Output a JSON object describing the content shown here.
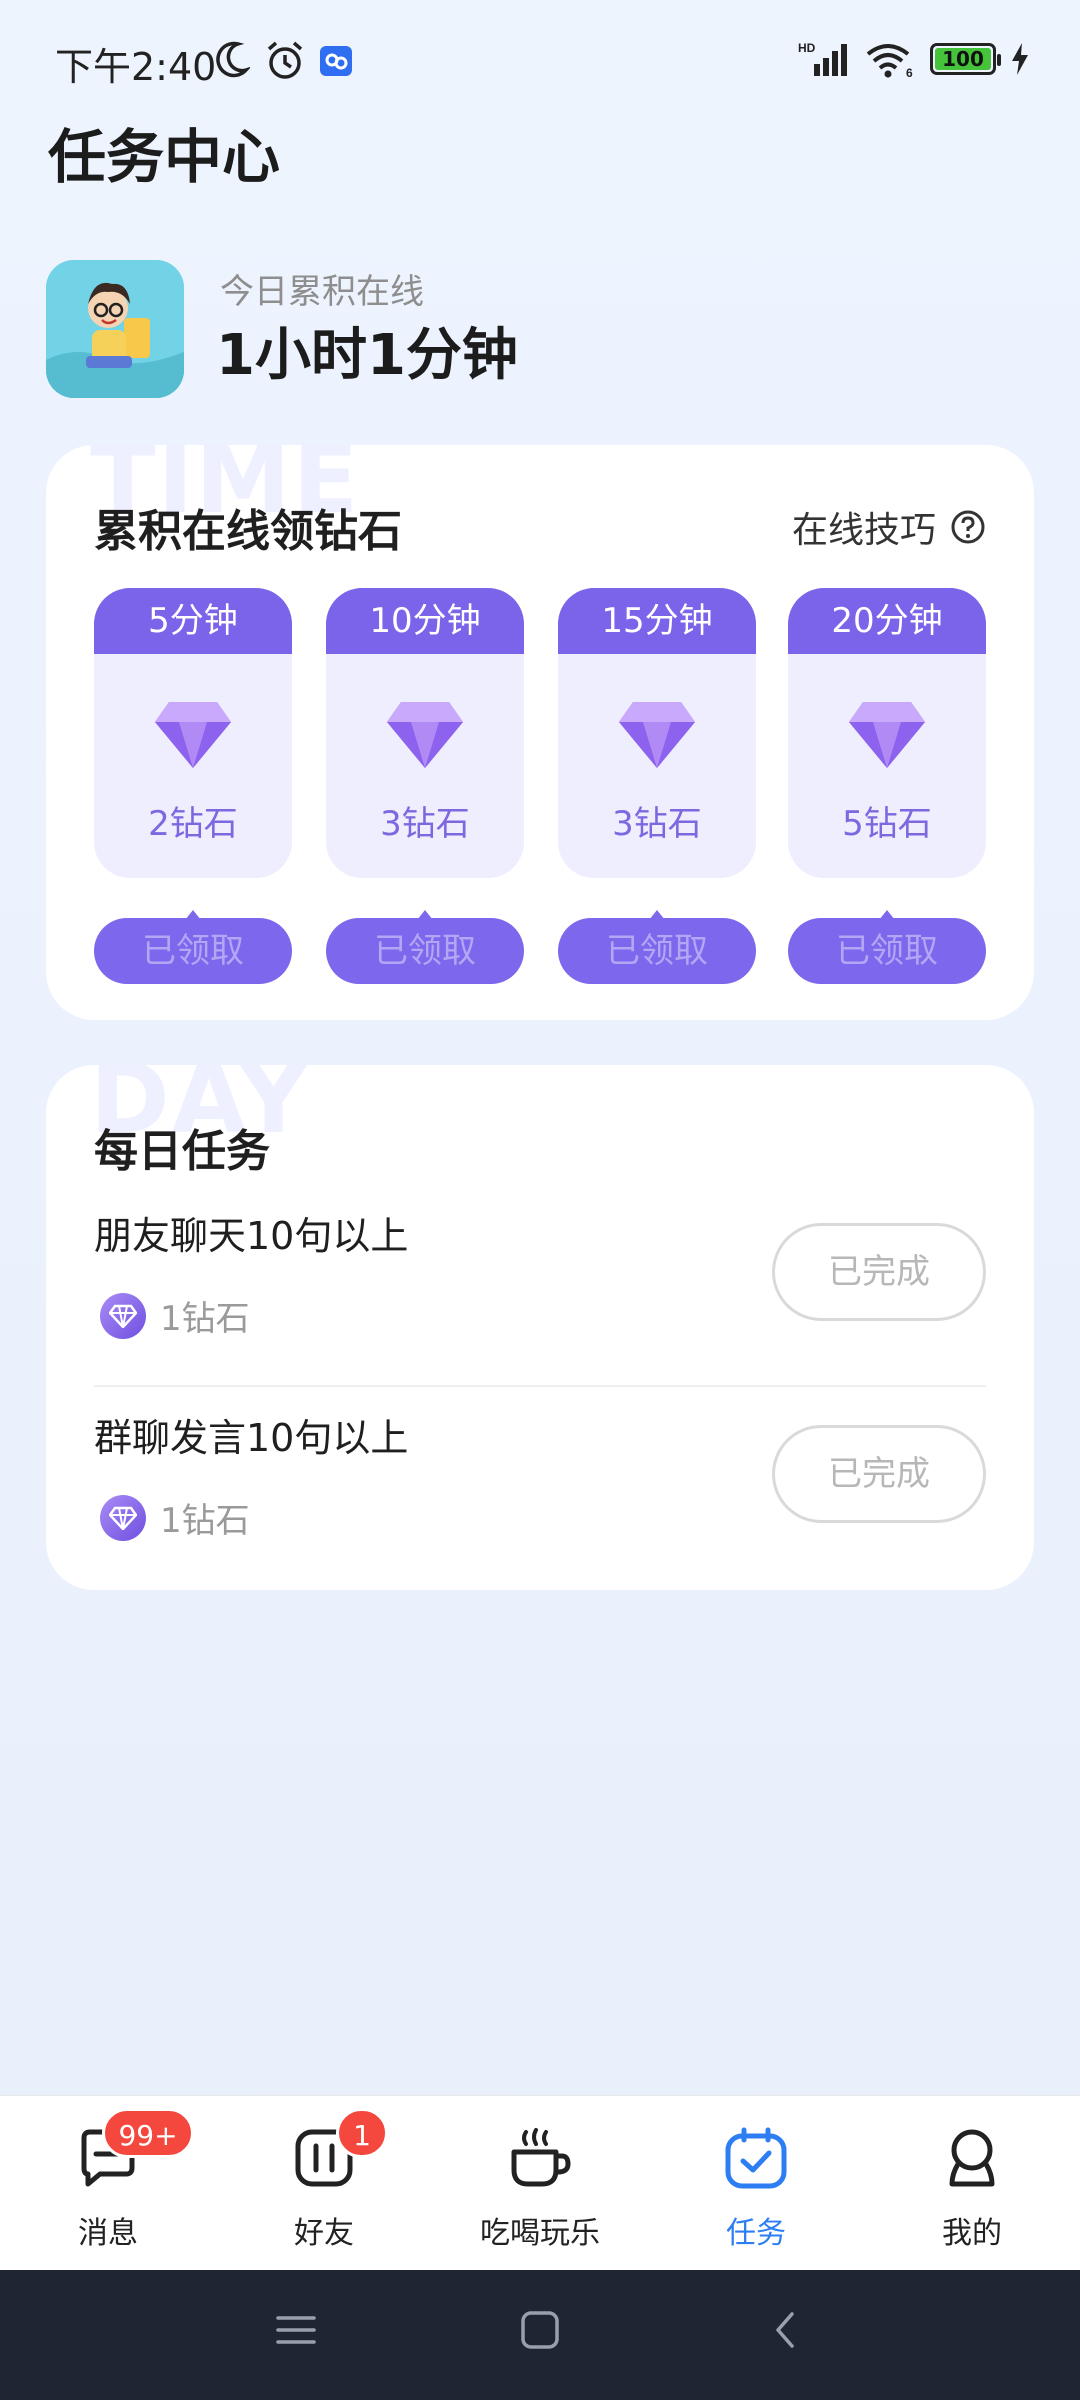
{
  "status_bar": {
    "time": "下午2:40",
    "battery": "100"
  },
  "page": {
    "title": "任务中心"
  },
  "summary": {
    "label": "今日累积在线",
    "value": "1小时1分钟"
  },
  "online_card": {
    "watermark": "TIME",
    "title": "累积在线领钻石",
    "tips_label": "在线技巧",
    "tiers": [
      {
        "duration": "5分钟",
        "reward": "2钻石",
        "button": "已领取"
      },
      {
        "duration": "10分钟",
        "reward": "3钻石",
        "button": "已领取"
      },
      {
        "duration": "15分钟",
        "reward": "3钻石",
        "button": "已领取"
      },
      {
        "duration": "20分钟",
        "reward": "5钻石",
        "button": "已领取"
      }
    ]
  },
  "daily_card": {
    "watermark": "DAY",
    "title": "每日任务",
    "tasks": [
      {
        "name": "朋友聊天10句以上",
        "reward": "1钻石",
        "button": "已完成"
      },
      {
        "name": "群聊发言10句以上",
        "reward": "1钻石",
        "button": "已完成"
      }
    ]
  },
  "tabbar": {
    "tabs": [
      {
        "label": "消息",
        "badge": "99+",
        "icon": "chat-icon"
      },
      {
        "label": "好友",
        "badge": "1",
        "icon": "friends-icon"
      },
      {
        "label": "吃喝玩乐",
        "icon": "coffee-cup-icon"
      },
      {
        "label": "任务",
        "icon": "calendar-check-icon",
        "active": true
      },
      {
        "label": "我的",
        "icon": "profile-icon"
      }
    ]
  },
  "colors": {
    "accent": "#7b63ea",
    "tab_active": "#2d7ef3",
    "badge": "#f4473d",
    "background": "#eaf1fd"
  }
}
